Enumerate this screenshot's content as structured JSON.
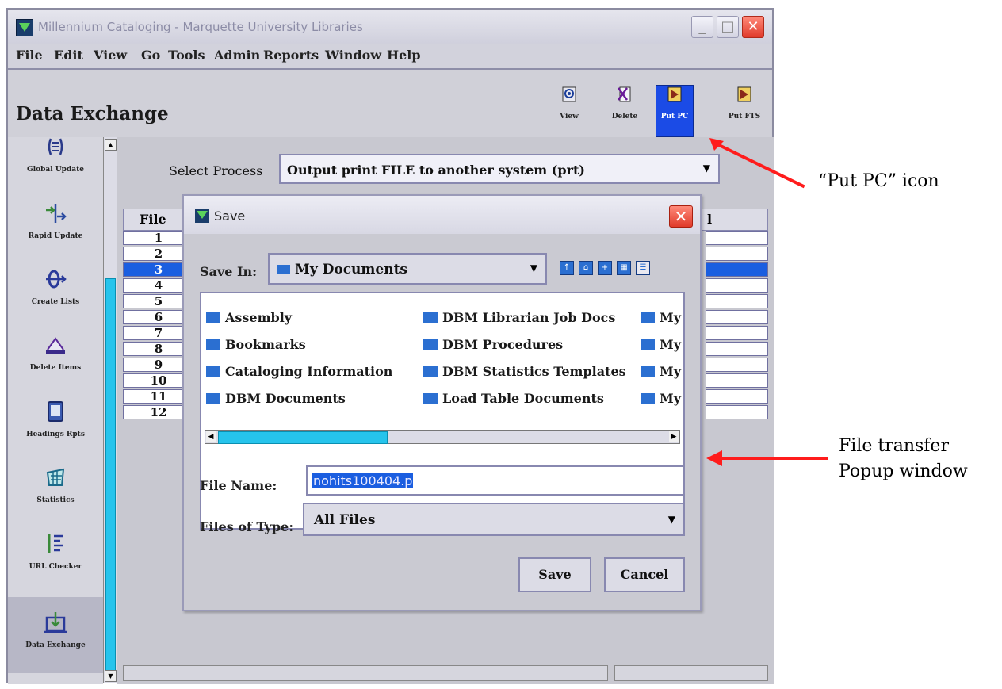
{
  "app": {
    "title": "Millennium Cataloging - Marquette University Libraries"
  },
  "menu": [
    "File",
    "Edit",
    "View",
    "Go",
    "Tools",
    "Admin",
    "Reports",
    "Window",
    "Help"
  ],
  "page_title": "Data Exchange",
  "toolbar": [
    {
      "label": "View",
      "icon": "eye-icon"
    },
    {
      "label": "Delete",
      "icon": "delete-icon"
    },
    {
      "label": "Put PC",
      "icon": "put-pc-icon",
      "active": true
    },
    {
      "label": "Put FTS",
      "icon": "put-fts-icon"
    }
  ],
  "sidebar": [
    {
      "label": "Global Update",
      "icon": "global-update-icon"
    },
    {
      "label": "Rapid Update",
      "icon": "rapid-update-icon"
    },
    {
      "label": "Create Lists",
      "icon": "create-lists-icon"
    },
    {
      "label": "Delete Items",
      "icon": "delete-items-icon"
    },
    {
      "label": "Headings Rpts",
      "icon": "headings-rpts-icon"
    },
    {
      "label": "Statistics",
      "icon": "statistics-icon"
    },
    {
      "label": "URL Checker",
      "icon": "url-checker-icon"
    },
    {
      "label": "Data Exchange",
      "icon": "data-exchange-icon",
      "active": true
    }
  ],
  "select_process": {
    "label": "Select Process",
    "value": "Output print FILE to another system (prt)"
  },
  "file_table": {
    "headers": [
      "File",
      "l"
    ],
    "rows": [
      "1",
      "2",
      "3",
      "4",
      "5",
      "6",
      "7",
      "8",
      "9",
      "10",
      "11",
      "12"
    ],
    "selected_row": "3"
  },
  "dialog": {
    "title": "Save",
    "save_in_label": "Save In:",
    "save_in_value": "My Documents",
    "files": [
      "Assembly",
      "Bookmarks",
      "Cataloging Information",
      "DBM Documents",
      "DBM Librarian Job Docs",
      "DBM Procedures",
      "DBM Statistics Templates",
      "Load Table Documents",
      "My",
      "My",
      "My",
      "My"
    ],
    "file_name_label": "File Name:",
    "file_name_value": "nohits100404.p",
    "files_of_type_label": "Files of Type:",
    "files_of_type_value": "All Files",
    "save_button": "Save",
    "cancel_button": "Cancel"
  },
  "annotations": {
    "put_pc": "“Put PC” icon",
    "popup_line1": "File transfer",
    "popup_line2": "Popup window"
  },
  "colors": {
    "accent": "#1b5ee0",
    "scroll": "#26c4ec",
    "arrow": "#ff1c1c"
  }
}
